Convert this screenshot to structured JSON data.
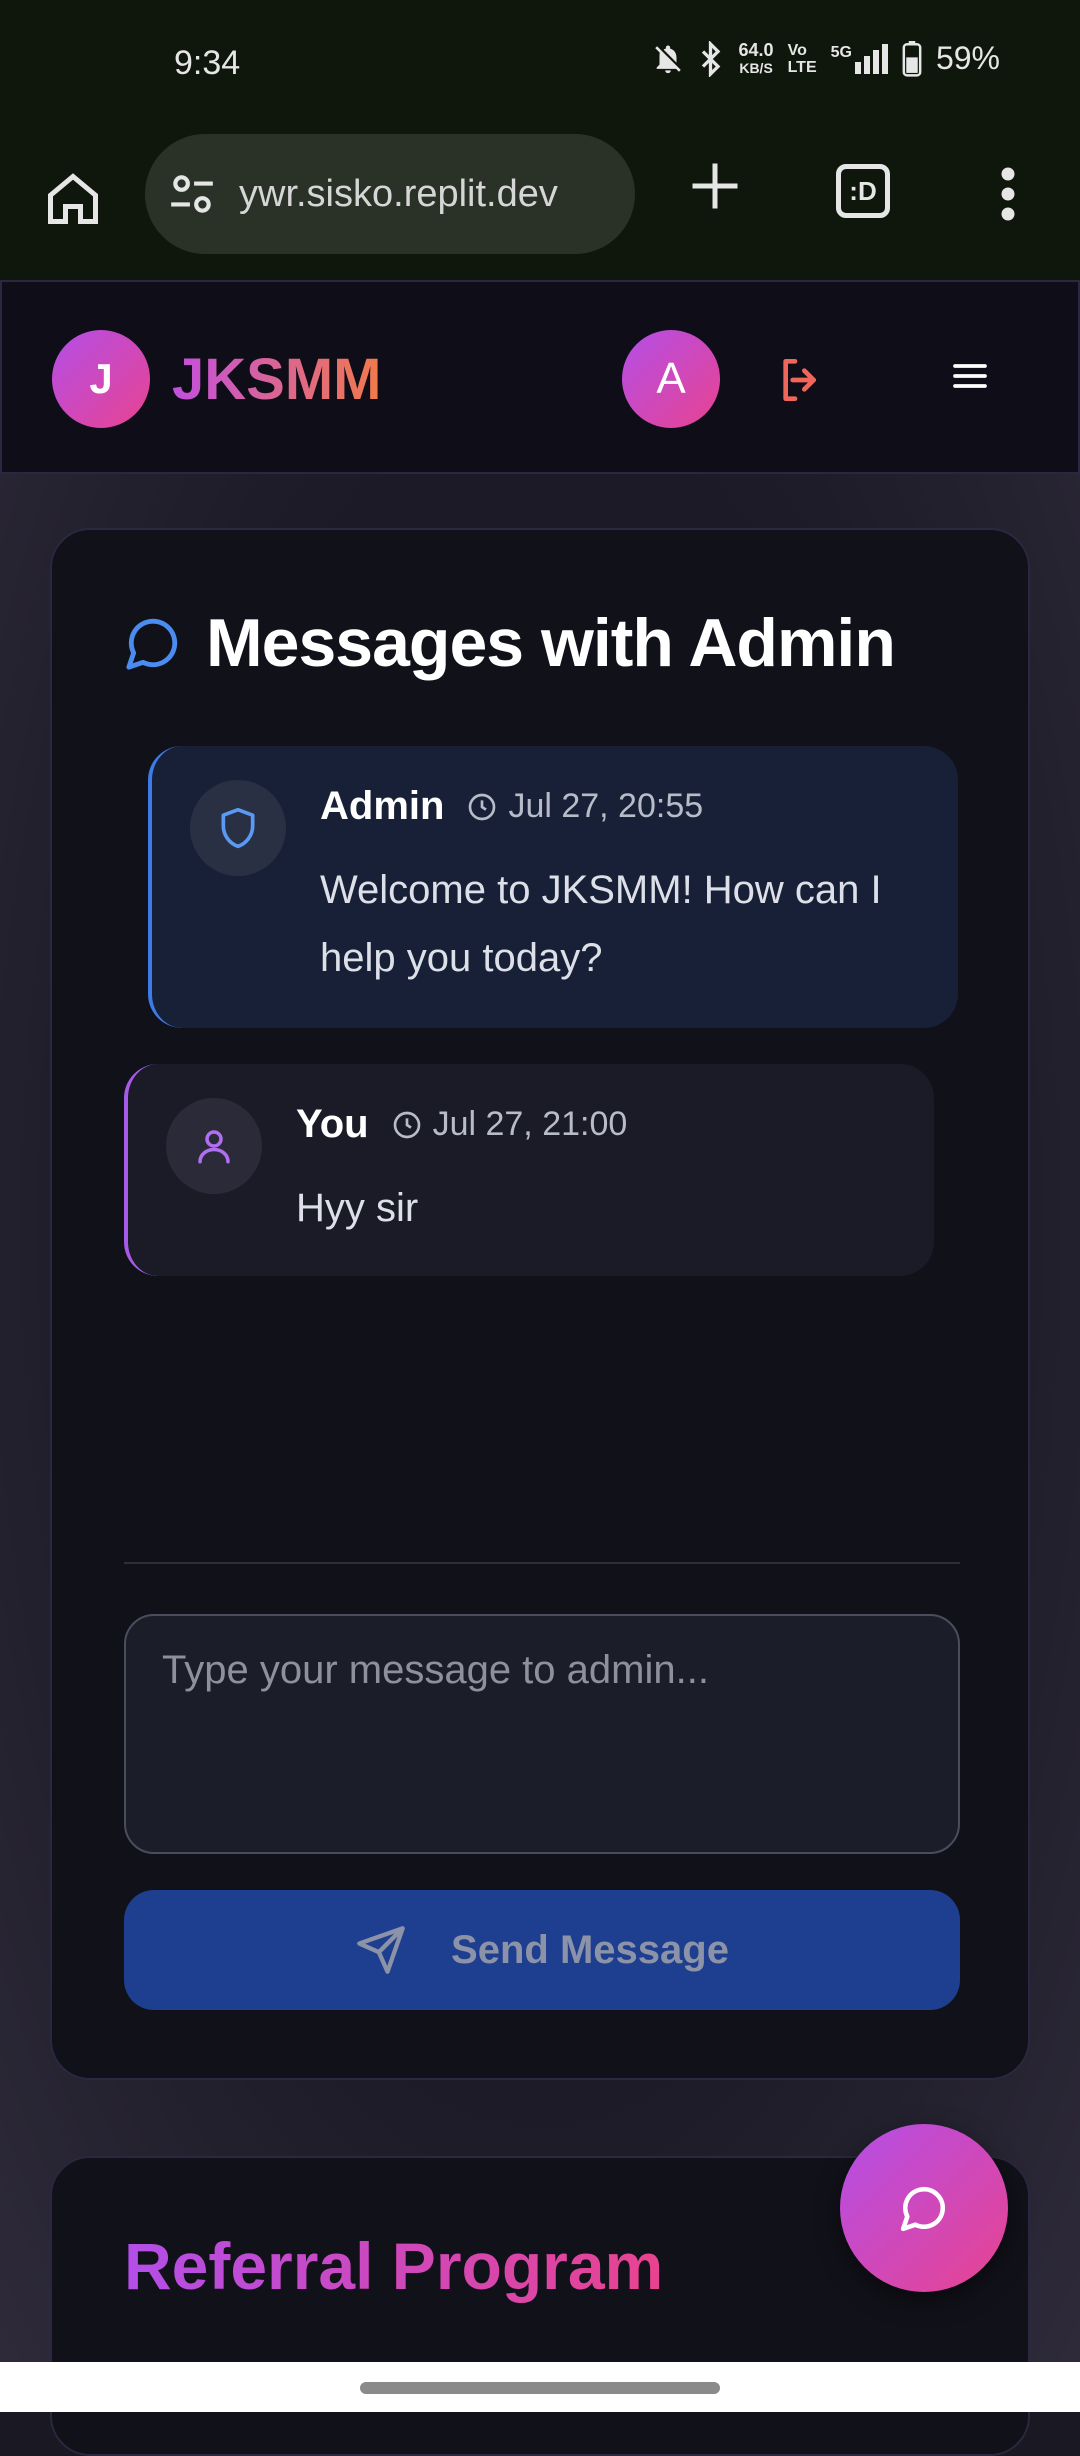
{
  "status_bar": {
    "time": "9:34",
    "net_speed_value": "64.0",
    "net_speed_unit": "KB/S",
    "volte_top": "Vo",
    "volte_bottom": "LTE",
    "network": "5G",
    "battery": "59%"
  },
  "browser": {
    "url": "ywr.sisko.replit.dev",
    "tabs_label": ":D",
    "icons": [
      "home-icon",
      "tune-icon",
      "plus-icon",
      "tabs-icon",
      "more-vert-icon"
    ]
  },
  "header": {
    "logo_letter": "J",
    "brand": "JKSMM",
    "avatar_letter": "A",
    "icons": [
      "logout-icon",
      "hamburger-icon"
    ]
  },
  "messages_card": {
    "title": "Messages with Admin",
    "title_icon": "message-circle-icon",
    "messages": [
      {
        "sender": "Admin",
        "time": "Jul 27, 20:55",
        "text": "Welcome to JKSMM! How can I help you today?",
        "icon": "shield-icon"
      },
      {
        "sender": "You",
        "time": "Jul 27, 21:00",
        "text": "Hyy sir",
        "icon": "user-icon"
      }
    ],
    "input": {
      "placeholder": "Type your message to admin...",
      "value": ""
    },
    "send_label": "Send Message",
    "send_icon": "send-icon"
  },
  "referral_card": {
    "title": "Referral Program"
  },
  "fab": {
    "icon": "message-circle-icon"
  },
  "colors": {
    "accent_purple": "#b34ee8",
    "accent_pink": "#e9438f",
    "admin_border": "#3d7be8",
    "user_border": "#a55be8",
    "send_button": "#1e3f8f"
  }
}
